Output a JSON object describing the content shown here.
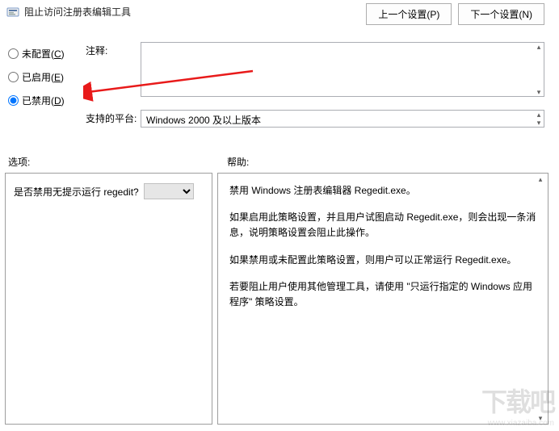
{
  "header": {
    "title": "阻止访问注册表编辑工具"
  },
  "nav": {
    "prev": "上一个设置(P)",
    "next": "下一个设置(N)"
  },
  "radios": {
    "not_configured": "未配置(C)",
    "enabled": "已启用(E)",
    "disabled": "已禁用(D)",
    "selected": "disabled"
  },
  "comment": {
    "label": "注释:",
    "value": ""
  },
  "platform": {
    "label": "支持的平台:",
    "value": "Windows 2000 及以上版本"
  },
  "sections": {
    "options": "选项:",
    "help": "帮助:"
  },
  "options": {
    "question": "是否禁用无提示运行 regedit?",
    "select_value": ""
  },
  "help": {
    "p1": "禁用 Windows 注册表编辑器 Regedit.exe。",
    "p2": "如果启用此策略设置，并且用户试图启动 Regedit.exe，则会出现一条消息，说明策略设置会阻止此操作。",
    "p3": "如果禁用或未配置此策略设置，则用户可以正常运行 Regedit.exe。",
    "p4": "若要阻止用户使用其他管理工具，请使用 \"只运行指定的 Windows 应用程序\" 策略设置。"
  },
  "watermark": {
    "brand": "下载吧",
    "url": "www.xiazaiba.com"
  }
}
